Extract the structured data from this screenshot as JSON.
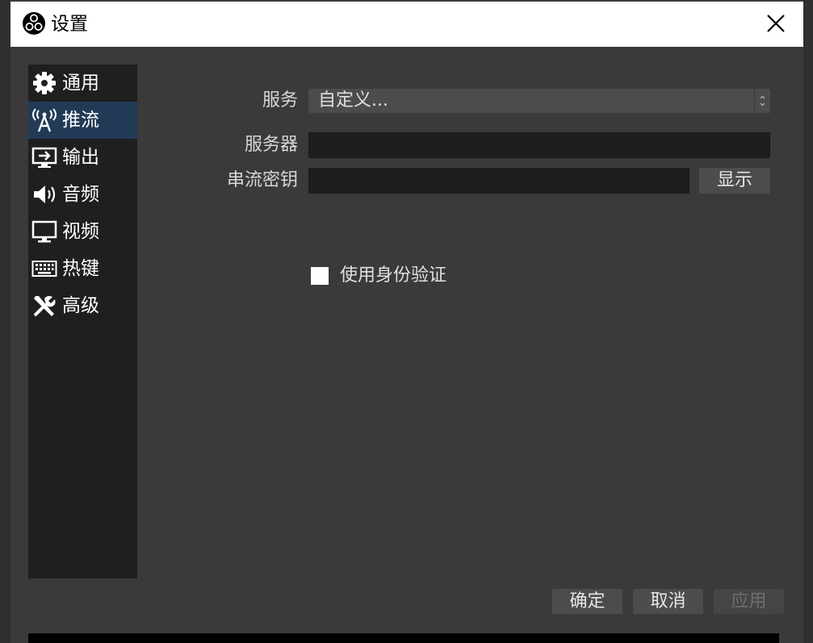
{
  "window": {
    "title": "设置",
    "logo_icon": "obs-logo-icon",
    "close_icon": "close-icon"
  },
  "sidebar": {
    "items": [
      {
        "label": "通用",
        "icon": "gear-icon",
        "active": false
      },
      {
        "label": "推流",
        "icon": "broadcast-antenna-icon",
        "active": true
      },
      {
        "label": "输出",
        "icon": "output-monitor-icon",
        "active": false
      },
      {
        "label": "音频",
        "icon": "speaker-icon",
        "active": false
      },
      {
        "label": "视频",
        "icon": "monitor-icon",
        "active": false
      },
      {
        "label": "热键",
        "icon": "keyboard-icon",
        "active": false
      },
      {
        "label": "高级",
        "icon": "tools-icon",
        "active": false
      }
    ]
  },
  "stream": {
    "service_label": "服务",
    "service_value": "自定义...",
    "server_label": "服务器",
    "server_value": "",
    "key_label": "串流密钥",
    "key_value": "",
    "show_button": "显示",
    "auth_label": "使用身份验证",
    "auth_checked": false
  },
  "footer": {
    "ok": "确定",
    "cancel": "取消",
    "apply": "应用"
  },
  "colors": {
    "background": "#3a3a3a",
    "sidebar": "#1f1f1f",
    "active_item": "#213b57",
    "input": "#1e1e1e",
    "button": "#4c4c4c"
  }
}
